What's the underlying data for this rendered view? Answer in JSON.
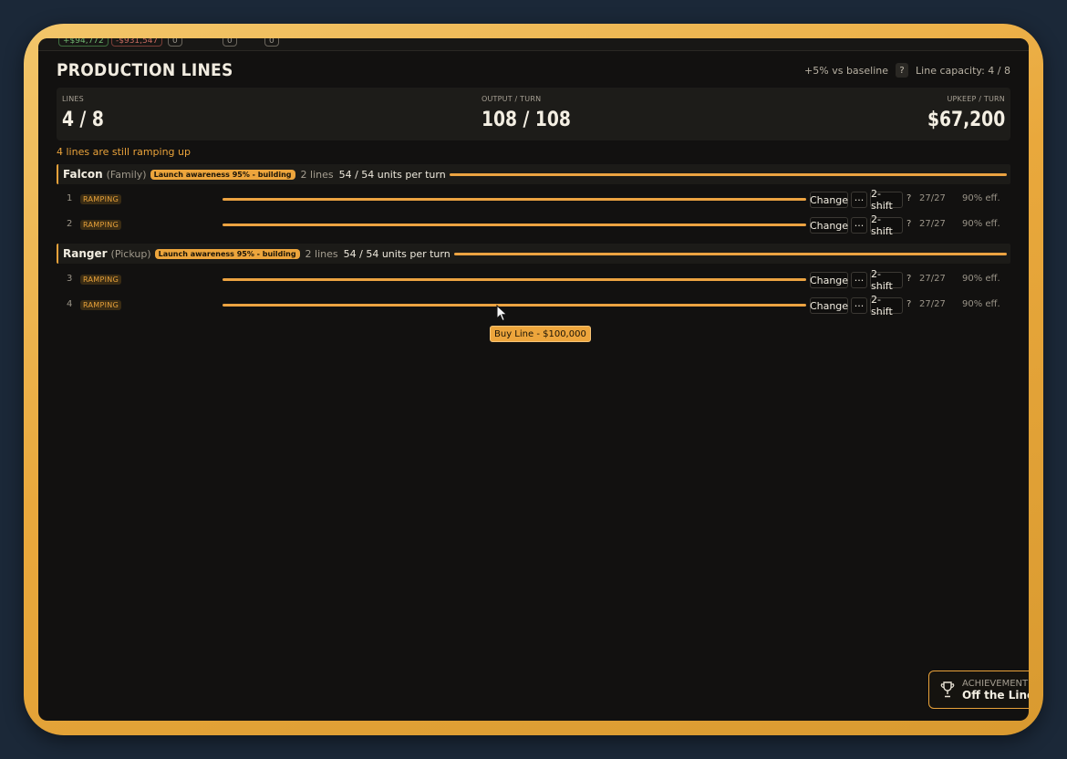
{
  "topbar": {
    "pills": [
      "+$94,772",
      "-$931,547",
      "0",
      "0",
      "0"
    ]
  },
  "header": {
    "title": "PRODUCTION LINES",
    "baseline": "+5% vs baseline",
    "help": "?",
    "capacity": "Line capacity: 4 / 8"
  },
  "stats": {
    "lines_label": "LINES",
    "lines_value": "4 / 8",
    "output_label": "OUTPUT / TURN",
    "output_value": "108 / 108",
    "upkeep_label": "UPKEEP / TURN",
    "upkeep_value": "$67,200"
  },
  "ramp_note": "4 lines are still ramping up",
  "groups": [
    {
      "name": "Falcon",
      "type": "(Family)",
      "badge": "Launch awareness 95% - building",
      "lines": "2 lines",
      "units": "54 / 54 units per turn",
      "rows": [
        {
          "num": "1",
          "status": "RAMPING",
          "change": "Change",
          "more": "···",
          "shift": "2-shift",
          "q": "?",
          "cap": "27/27",
          "eff": "90% eff."
        },
        {
          "num": "2",
          "status": "RAMPING",
          "change": "Change",
          "more": "···",
          "shift": "2-shift",
          "q": "?",
          "cap": "27/27",
          "eff": "90% eff."
        }
      ]
    },
    {
      "name": "Ranger",
      "type": "(Pickup)",
      "badge": "Launch awareness 95% - building",
      "lines": "2 lines",
      "units": "54 / 54 units per turn",
      "rows": [
        {
          "num": "3",
          "status": "RAMPING",
          "change": "Change",
          "more": "···",
          "shift": "2-shift",
          "q": "?",
          "cap": "27/27",
          "eff": "90% eff."
        },
        {
          "num": "4",
          "status": "RAMPING",
          "change": "Change",
          "more": "···",
          "shift": "2-shift",
          "q": "?",
          "cap": "27/27",
          "eff": "90% eff."
        }
      ]
    }
  ],
  "buy_button": "Buy Line - $100,000",
  "achievement": {
    "icon": "trophy-icon",
    "label": "ACHIEVEMENT",
    "name": "Off the Line"
  },
  "colors": {
    "accent": "#eca341",
    "bezel": "#e9a83c",
    "background": "#121110"
  }
}
